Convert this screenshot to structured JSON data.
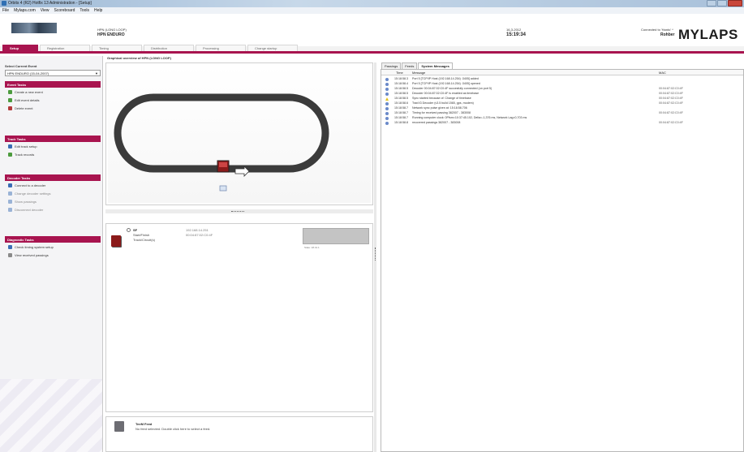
{
  "window": {
    "title": "Orbits 4 (R2) Hotfix 13 Administration - [Setup]"
  },
  "menu": [
    "File",
    "Mylaps.com",
    "View",
    "Scoreboard",
    "Tools",
    "Help"
  ],
  "header": {
    "loop_name": "HPN (LONG LOOP)",
    "loop_sub": "HPN ENDURO",
    "date": "16-3-2012",
    "clock": "15:19:34",
    "connected": "Connected to 'Hanto' *",
    "user": "Rohber",
    "brand": "MYLAPS"
  },
  "tabs": [
    {
      "label": "Setup",
      "active": true
    },
    {
      "label": "Registration",
      "active": false
    },
    {
      "label": "Timing",
      "active": false
    },
    {
      "label": "Distribution",
      "active": false
    },
    {
      "label": "Processing",
      "active": false
    },
    {
      "label": "Change startup",
      "active": false
    }
  ],
  "sidebar": {
    "select_label": "Select Current Event",
    "select_value": "HPN ENDURO (15-04-2007)",
    "sections": [
      {
        "title": "Event Tasks",
        "items": [
          {
            "label": "Create a new event",
            "icon": "green",
            "enabled": true
          },
          {
            "label": "Edit event details",
            "icon": "green",
            "enabled": true
          },
          {
            "label": "Delete event",
            "icon": "red",
            "enabled": true
          }
        ]
      },
      {
        "title": "Track Tasks",
        "items": [
          {
            "label": "Edit track setup",
            "icon": "blue",
            "enabled": true
          },
          {
            "label": "Track records",
            "icon": "green",
            "enabled": true
          }
        ]
      },
      {
        "title": "Decoder Tasks",
        "items": [
          {
            "label": "Connect to a decoder",
            "icon": "blue",
            "enabled": true
          },
          {
            "label": "Change decoder settings",
            "icon": "dim",
            "enabled": false
          },
          {
            "label": "Show passings",
            "icon": "dim",
            "enabled": false
          },
          {
            "label": "Disconnect decoder",
            "icon": "dim",
            "enabled": false
          }
        ]
      },
      {
        "title": "Diagnostic Tasks",
        "items": [
          {
            "label": "Check timing system setup",
            "icon": "blue",
            "enabled": true
          },
          {
            "label": "View received passings",
            "icon": "gray",
            "enabled": true
          }
        ]
      }
    ]
  },
  "overview": {
    "title": "Graphical overview of HPN (LONG LOOP)"
  },
  "decoder": {
    "name": "SF",
    "type": "Start/Finish",
    "mode": "Track/Circuit(s)",
    "ip": "192.168.14.251",
    "mac": "00:04:87:02:C0:4F",
    "bar_caption": "State: 18.41.1"
  },
  "feed": {
    "title": "TeeM Feed",
    "text": "No feed selected. Double click here to select a feed."
  },
  "messages": {
    "tabs": [
      {
        "label": "Passings",
        "active": false
      },
      {
        "label": "Feeds",
        "active": false
      },
      {
        "label": "System Messages",
        "active": true
      }
    ],
    "columns": {
      "time": "Time",
      "message": "Message",
      "mac": "MAC"
    },
    "rows": [
      {
        "time": "15:18:58.3",
        "message": "Port 5 [TCP/IP Host (192.168.14.254) :3405] added",
        "mac": "",
        "level": "info"
      },
      {
        "time": "15:18:58.4",
        "message": "Port 5 [TCP/IP Host (192.168.14.254) :3405] opened",
        "mac": "",
        "level": "info"
      },
      {
        "time": "15:18:58.5",
        "message": "Decoder 00:04:87:02:C0:4F succesfully connected (on port 5)",
        "mac": "00:04:87:02:C0:4F",
        "level": "info"
      },
      {
        "time": "15:18:58.5",
        "message": "Decoder 00:04:87:02:C0:4F is enabled as timebase",
        "mac": "00:04:87:02:C0:4F",
        "level": "info"
      },
      {
        "time": "15:18:58.5",
        "message": "Sync started because of: Change of timebase",
        "mac": "00:04:87:02:C0:4F",
        "level": "warn"
      },
      {
        "time": "15:18:58.6",
        "message": "TranX3 Decoder (v3.5 build 1565, gps, modem)",
        "mac": "00:04:87:02:C0:4F",
        "level": "info"
      },
      {
        "time": "15:18:58.7",
        "message": "Network sync pulse given at: 15:18:58.706",
        "mac": "",
        "level": "info"
      },
      {
        "time": "15:18:58.7",
        "message": "Timing for received passing 382007 - 383008",
        "mac": "00:04:87:02:C0:4F",
        "level": "info"
      },
      {
        "time": "15:18:58.7",
        "message": "Running computer clock: 0Pfsm=10:37:45.102, Delta=-1,376 ms, Network Lag=0,703 ms",
        "mac": "",
        "level": "info"
      },
      {
        "time": "15:18:58.8",
        "message": "recovered passings 382007 - 383008",
        "mac": "00:04:87:02:C0:4F",
        "level": "info"
      }
    ]
  },
  "colors": {
    "accent": "#a8144f",
    "track": "#3b3b3b"
  }
}
